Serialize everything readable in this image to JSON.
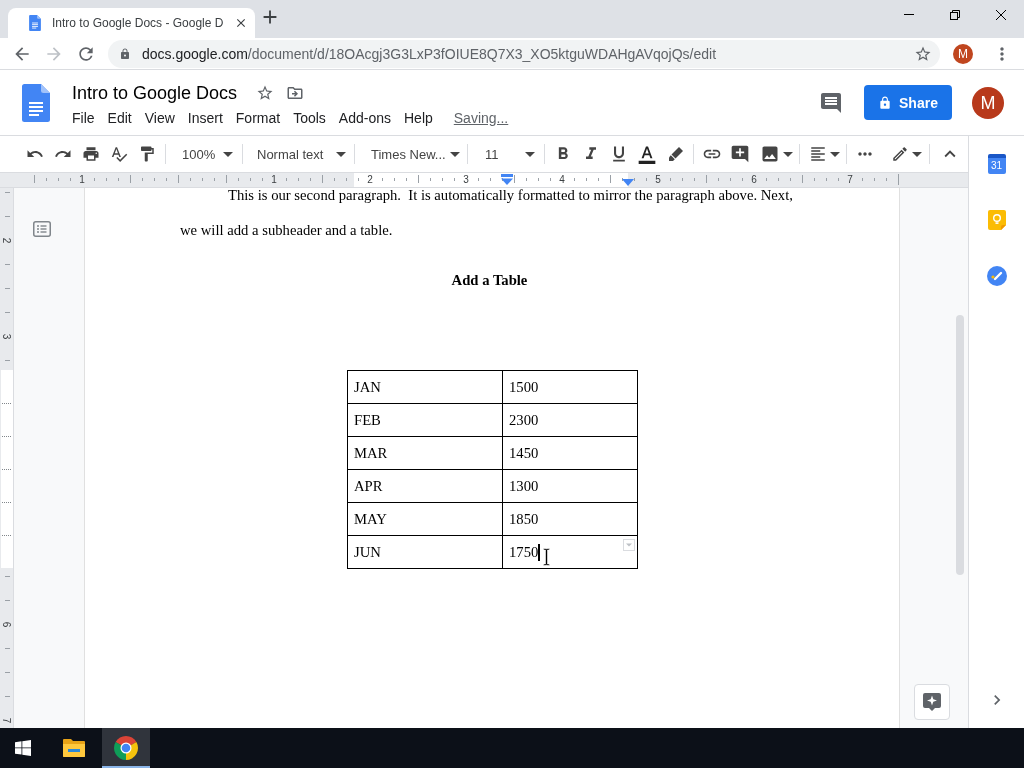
{
  "browser": {
    "tab_title": "Intro to Google Docs - Google D",
    "forward_disabled": true,
    "url_host": "docs.google.com",
    "url_path": "/document/d/18OAcgj3G3LxP3fOIUE8Q7X3_XO5ktguWDAHgAVqojQs/edit",
    "profile_initial": "M"
  },
  "docs_header": {
    "title": "Intro to Google Docs",
    "menu": [
      "File",
      "Edit",
      "View",
      "Insert",
      "Format",
      "Tools",
      "Add-ons",
      "Help"
    ],
    "save_status": "Saving...",
    "share_button": "Share",
    "account_initial": "M"
  },
  "toolbar": {
    "zoom": "100%",
    "paragraph_style": "Normal text",
    "font": "Times New...",
    "font_size": "11"
  },
  "ruler": {
    "labels": [
      "1",
      "1",
      "2",
      "3",
      "4",
      "5",
      "6",
      "7"
    ]
  },
  "vertical_ruler": {
    "labels": [
      "2",
      "3",
      "6",
      "7"
    ]
  },
  "document": {
    "paragraph": "This is our second paragraph.  It is automatically formatted to mirror the paragraph above. Next, we will add a subheader and a table.",
    "heading": "Add a Table",
    "table": {
      "rows": [
        {
          "cells": [
            "JAN",
            "1500"
          ],
          "focused": false
        },
        {
          "cells": [
            "FEB",
            "2300"
          ],
          "focused": false
        },
        {
          "cells": [
            "MAR",
            "1450"
          ],
          "focused": false
        },
        {
          "cells": [
            "APR",
            "1300"
          ],
          "focused": false
        },
        {
          "cells": [
            "MAY",
            "1850"
          ],
          "focused": false
        },
        {
          "cells": [
            "JUN",
            "1750"
          ],
          "focused": true
        }
      ]
    }
  },
  "side_panel": {
    "calendar_day": "31"
  },
  "taskbar": {
    "apps": [
      {
        "kind": "file-explorer",
        "active": false
      },
      {
        "kind": "chrome",
        "active": true
      }
    ]
  }
}
